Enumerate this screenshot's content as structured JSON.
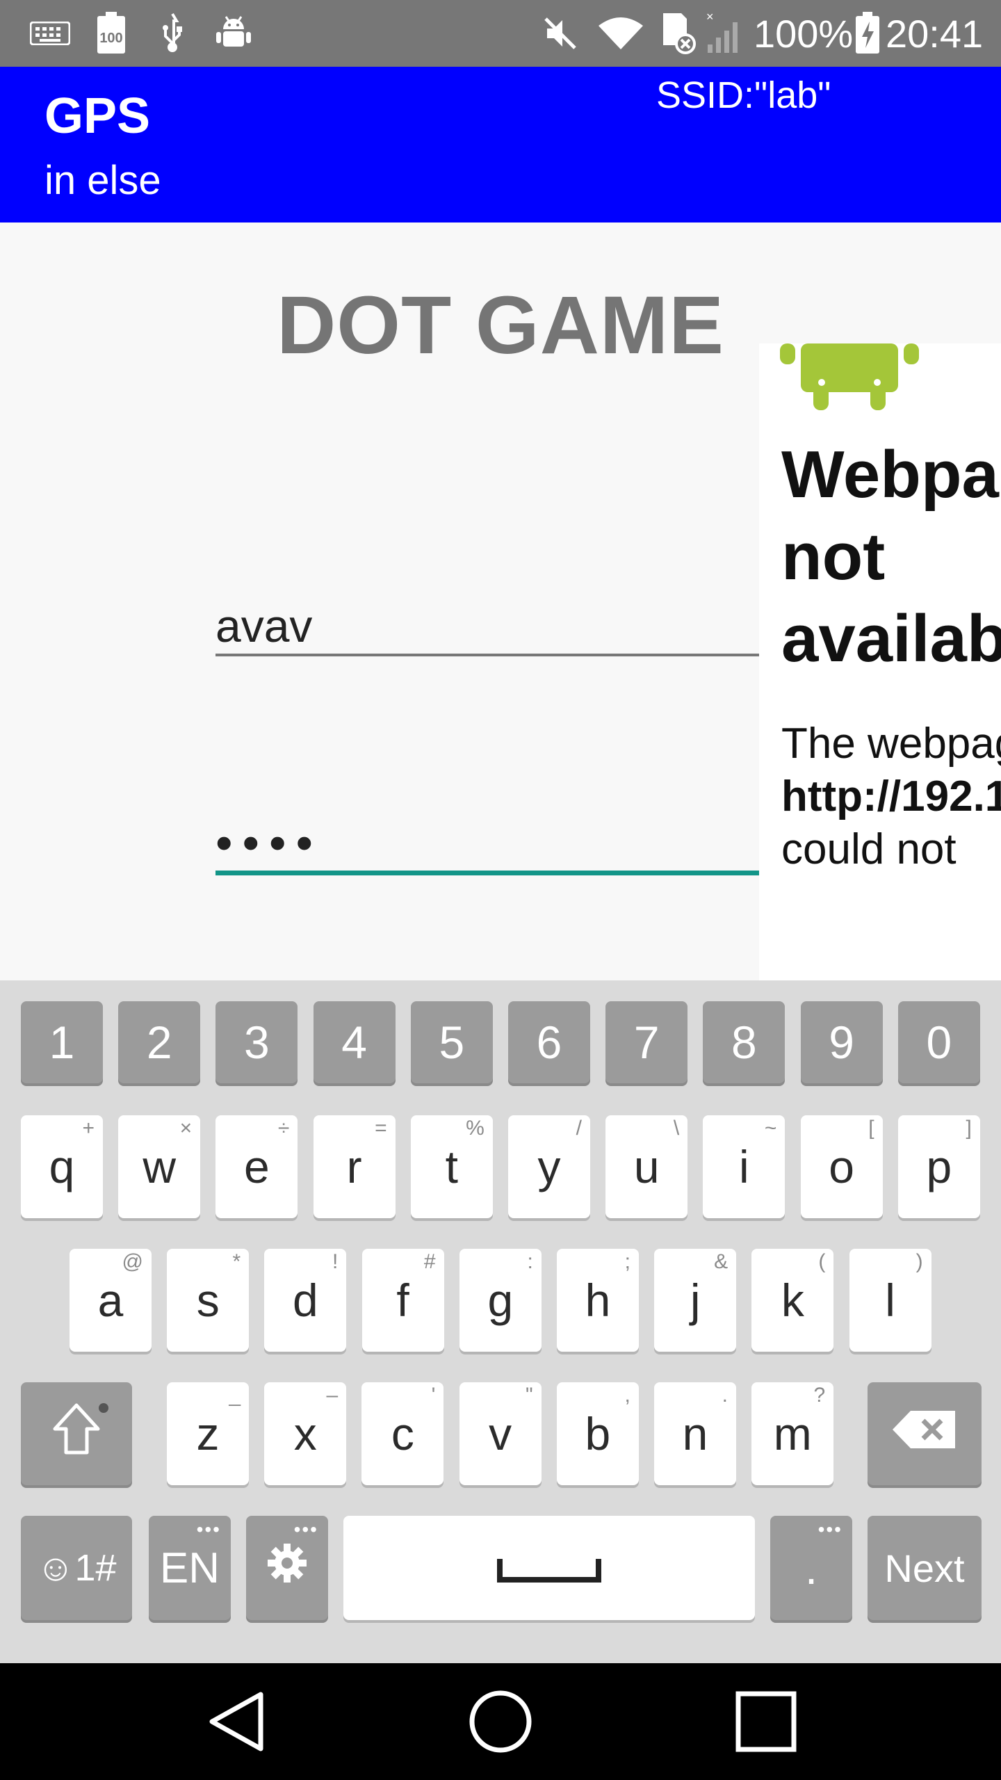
{
  "status_bar": {
    "battery_percent": "100%",
    "time": "20:41",
    "left_icons": [
      "keyboard-icon",
      "battery-100-icon",
      "usb-icon",
      "android-debug-icon"
    ],
    "right_icons": [
      "mute-icon",
      "wifi-icon",
      "sd-card-icon",
      "signal-icon",
      "battery-charging-icon"
    ]
  },
  "app_bar": {
    "title": "GPS",
    "subtitle": "in else",
    "ssid": "SSID:\"lab\""
  },
  "main": {
    "title": "DOT GAME",
    "username_value": "avav",
    "password_value": "••••"
  },
  "web_panel": {
    "heading": "Webpage not available",
    "body_prefix": "The webpage at",
    "url": "http://192.1",
    "body_suffix": "could not"
  },
  "keyboard": {
    "number_row": [
      "1",
      "2",
      "3",
      "4",
      "5",
      "6",
      "7",
      "8",
      "9",
      "0"
    ],
    "row1": [
      {
        "key": "q",
        "hint": "+"
      },
      {
        "key": "w",
        "hint": "×"
      },
      {
        "key": "e",
        "hint": "÷"
      },
      {
        "key": "r",
        "hint": "="
      },
      {
        "key": "t",
        "hint": "%"
      },
      {
        "key": "y",
        "hint": "/"
      },
      {
        "key": "u",
        "hint": "\\"
      },
      {
        "key": "i",
        "hint": "~"
      },
      {
        "key": "o",
        "hint": "["
      },
      {
        "key": "p",
        "hint": "]"
      }
    ],
    "row2": [
      {
        "key": "a",
        "hint": "@"
      },
      {
        "key": "s",
        "hint": "*"
      },
      {
        "key": "d",
        "hint": "!"
      },
      {
        "key": "f",
        "hint": "#"
      },
      {
        "key": "g",
        "hint": ":"
      },
      {
        "key": "h",
        "hint": ";"
      },
      {
        "key": "j",
        "hint": "&"
      },
      {
        "key": "k",
        "hint": "("
      },
      {
        "key": "l",
        "hint": ")"
      }
    ],
    "row3": [
      {
        "key": "z",
        "hint": "_"
      },
      {
        "key": "x",
        "hint": "–"
      },
      {
        "key": "c",
        "hint": "'"
      },
      {
        "key": "v",
        "hint": "\""
      },
      {
        "key": "b",
        "hint": ","
      },
      {
        "key": "n",
        "hint": "."
      },
      {
        "key": "m",
        "hint": "?"
      }
    ],
    "symbols_label": "☺1#",
    "lang_label": "EN",
    "period_label": ".",
    "next_label": "Next"
  },
  "colors": {
    "app_bar": "#0000ff",
    "status_bar": "#777777",
    "accent": "#129588",
    "title_gray": "#757575"
  }
}
